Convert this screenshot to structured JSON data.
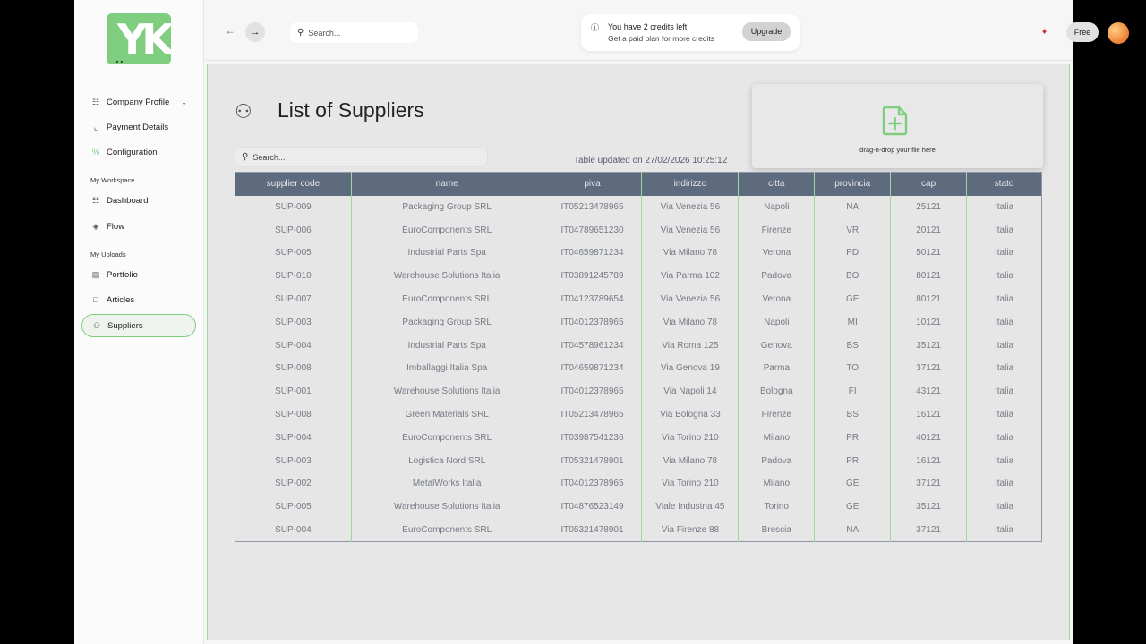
{
  "sidebar": {
    "logo_text": "YK",
    "items": [
      {
        "label": "Company Profile",
        "icon": "org-icon"
      },
      {
        "label": "Payment Details",
        "icon": "phone-icon"
      },
      {
        "label": "Configuration",
        "icon": "config-icon"
      },
      {
        "label": "Dashboard",
        "icon": "hierarchy-icon"
      },
      {
        "label": "Flow",
        "icon": "flow-icon"
      },
      {
        "label": "Portfolio",
        "icon": "folder-icon"
      },
      {
        "label": "Articles",
        "icon": "document-icon"
      },
      {
        "label": "Suppliers",
        "icon": "users-icon"
      }
    ],
    "sections": [
      "My Workspace",
      "My Uploads"
    ]
  },
  "topbar": {
    "search_placeholder": "Search...",
    "credits_line1": "You have 2 credits left",
    "credits_line2": "Get a paid plan for more credits",
    "upgrade_label": "Upgrade",
    "plan_label": "Free"
  },
  "main": {
    "title": "List of Suppliers",
    "search_placeholder": "Search...",
    "updated_text": "Table updated on 27/02/2026 10:25:12",
    "dropzone_text": "drag-n-drop your file here",
    "accent_color": "#7fce7f",
    "header_color": "#5e6a7e"
  },
  "table": {
    "columns": [
      "supplier code",
      "name",
      "piva",
      "indirizzo",
      "citta",
      "provincia",
      "cap",
      "stato"
    ],
    "rows": [
      [
        "SUP-009",
        "Packaging Group SRL",
        "IT05213478965",
        "Via Venezia 56",
        "Napoli",
        "NA",
        "25121",
        "Italia"
      ],
      [
        "SUP-006",
        "EuroComponents SRL",
        "IT04789651230",
        "Via Venezia 56",
        "Firenze",
        "VR",
        "20121",
        "Italia"
      ],
      [
        "SUP-005",
        "Industrial Parts Spa",
        "IT04659871234",
        "Via Milano 78",
        "Verona",
        "PD",
        "50121",
        "Italia"
      ],
      [
        "SUP-010",
        "Warehouse Solutions Italia",
        "IT03891245789",
        "Via Parma 102",
        "Padova",
        "BO",
        "80121",
        "Italia"
      ],
      [
        "SUP-007",
        "EuroComponents SRL",
        "IT04123789654",
        "Via Venezia 56",
        "Verona",
        "GE",
        "80121",
        "Italia"
      ],
      [
        "SUP-003",
        "Packaging Group SRL",
        "IT04012378965",
        "Via Milano 78",
        "Napoli",
        "MI",
        "10121",
        "Italia"
      ],
      [
        "SUP-004",
        "Industrial Parts Spa",
        "IT04578961234",
        "Via Roma 125",
        "Genova",
        "BS",
        "35121",
        "Italia"
      ],
      [
        "SUP-008",
        "Imballaggi Italia Spa",
        "IT04659871234",
        "Via Genova 19",
        "Parma",
        "TO",
        "37121",
        "Italia"
      ],
      [
        "SUP-001",
        "Warehouse Solutions Italia",
        "IT04012378965",
        "Via Napoli 14",
        "Bologna",
        "FI",
        "43121",
        "Italia"
      ],
      [
        "SUP-008",
        "Green Materials SRL",
        "IT05213478965",
        "Via Bologna 33",
        "Firenze",
        "BS",
        "16121",
        "Italia"
      ],
      [
        "SUP-004",
        "EuroComponents SRL",
        "IT03987541236",
        "Via Torino 210",
        "Milano",
        "PR",
        "40121",
        "Italia"
      ],
      [
        "SUP-003",
        "Logistica Nord SRL",
        "IT05321478901",
        "Via Milano 78",
        "Padova",
        "PR",
        "16121",
        "Italia"
      ],
      [
        "SUP-002",
        "MetalWorks Italia",
        "IT04012378965",
        "Via Torino 210",
        "Milano",
        "GE",
        "37121",
        "Italia"
      ],
      [
        "SUP-005",
        "Warehouse Solutions Italia",
        "IT04876523149",
        "Viale Industria 45",
        "Torino",
        "GE",
        "35121",
        "Italia"
      ],
      [
        "SUP-004",
        "EuroComponents SRL",
        "IT05321478901",
        "Via Firenze 88",
        "Brescia",
        "NA",
        "37121",
        "Italia"
      ]
    ]
  }
}
